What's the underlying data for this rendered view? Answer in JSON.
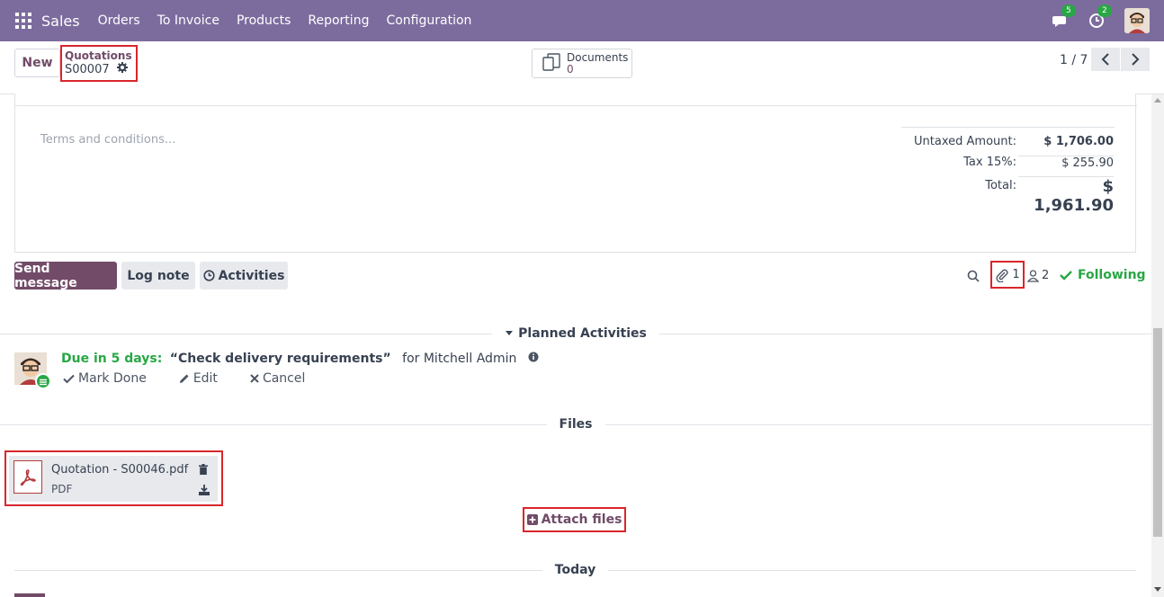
{
  "navbar": {
    "app_name": "Sales",
    "menu": [
      "Orders",
      "To Invoice",
      "Products",
      "Reporting",
      "Configuration"
    ],
    "messages_count": "5",
    "activities_count": "2"
  },
  "control_panel": {
    "new_label": "New",
    "breadcrumb_parent": "Quotations",
    "breadcrumb_current": "S00007",
    "documents_label": "Documents",
    "documents_count": "0",
    "pager": "1 / 7"
  },
  "sheet": {
    "terms_placeholder": "Terms and conditions...",
    "untaxed_label": "Untaxed Amount:",
    "untaxed_value": "$ 1,706.00",
    "tax_label": "Tax 15%:",
    "tax_value": "$ 255.90",
    "total_label": "Total:",
    "total_value": "$ 1,961.90"
  },
  "chatter": {
    "send_message": "Send message",
    "log_note": "Log note",
    "activities": "Activities",
    "attachment_count": "1",
    "follower_count": "2",
    "following": "Following",
    "planned_activities": "Planned Activities",
    "activity": {
      "due": "Due in 5 days:",
      "summary": "“Check delivery requirements”",
      "for": "for Mitchell Admin",
      "mark_done": "Mark Done",
      "edit": "Edit",
      "cancel": "Cancel"
    },
    "files_title": "Files",
    "file": {
      "name": "Quotation - S00046.pdf",
      "type": "PDF"
    },
    "attach_files": "Attach files",
    "today": "Today"
  },
  "colors": {
    "navbar": "#7c6c9e",
    "primary": "#714b67",
    "success": "#28a745",
    "highlight": "#d9262c"
  }
}
